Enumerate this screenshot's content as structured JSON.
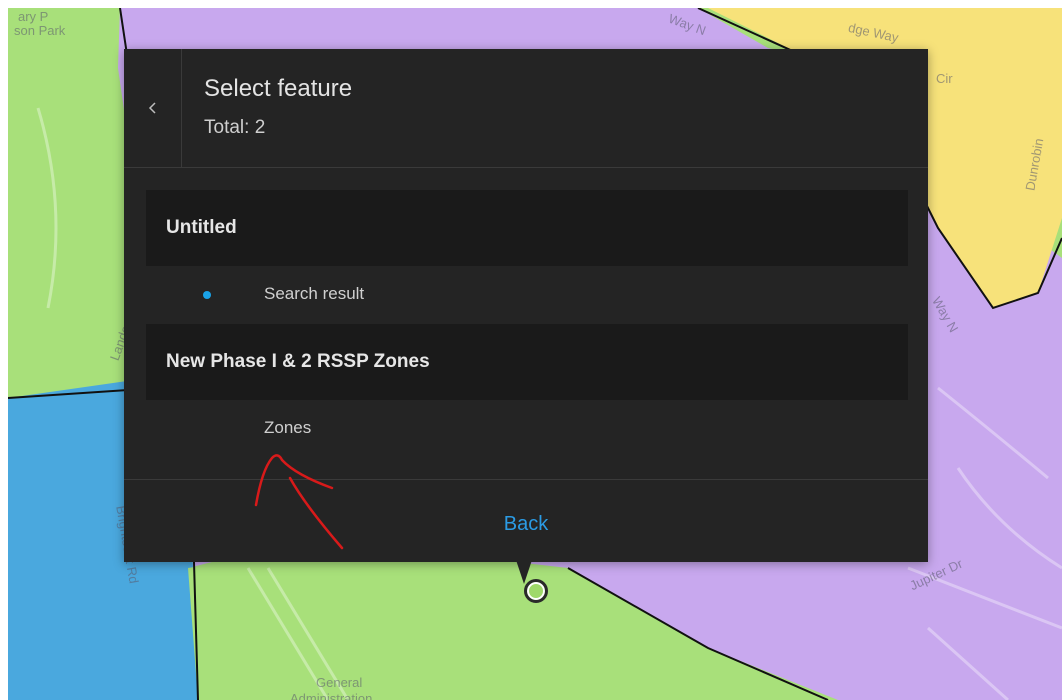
{
  "popup": {
    "title": "Select feature",
    "total": "Total: 2",
    "back_label": "Back",
    "groups": [
      {
        "name": "Untitled",
        "features": [
          {
            "label": "Search result",
            "marker_color": "#1aa3e8"
          }
        ]
      },
      {
        "name": "New Phase I & 2 RSSP Zones",
        "features": [
          {
            "label": "Zones"
          }
        ]
      }
    ],
    "accent_color": "#2b9be4"
  },
  "map": {
    "zone_colors": {
      "green": "#a8e07a",
      "purple": "#c8a8ee",
      "yellow": "#f7e27a",
      "blue": "#4aa8de"
    },
    "labels": [
      "ary P",
      "son Park",
      "Way N",
      "dge Way",
      "Cir",
      "Dunrobin",
      "Way N",
      "Landover",
      "Brightseat Rd",
      "Jupiter Dr",
      "General",
      "Administration"
    ]
  },
  "annotation": {
    "color": "#d81a1a"
  }
}
